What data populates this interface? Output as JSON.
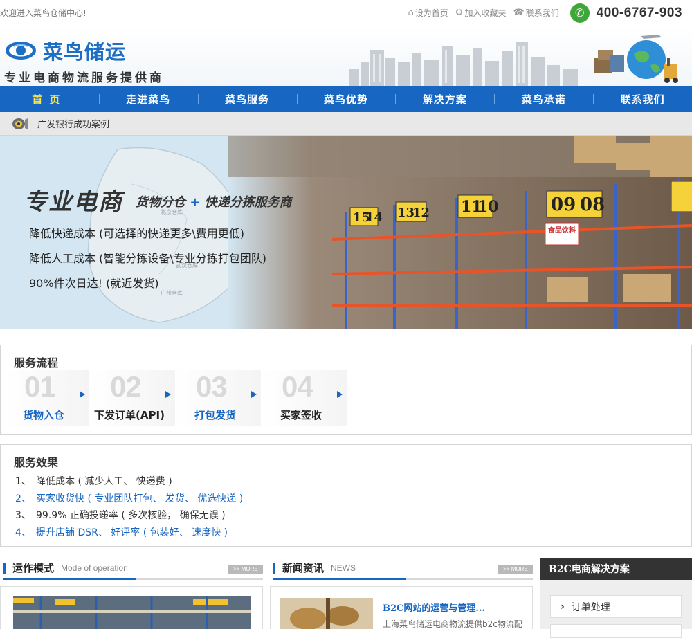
{
  "topbar": {
    "welcome": "欢迎进入菜鸟仓储中心!",
    "set_home": "设为首页",
    "bookmark": "加入收藏夹",
    "contact": "联系我们",
    "phone": "400-6767-903"
  },
  "brand": {
    "logo_text": "菜鸟储运",
    "slogan": "专业电商物流服务提供商"
  },
  "nav": [
    "首页",
    "走进菜鸟",
    "菜鸟服务",
    "菜鸟优势",
    "解决方案",
    "菜鸟承诺",
    "联系我们"
  ],
  "nav_active_index": 0,
  "ticker": {
    "text": "广发银行成功案例"
  },
  "banner": {
    "headline": "专业电商",
    "sub_a": "货物分仓",
    "sub_plus": "+",
    "sub_b": "快递分拣服务商",
    "points": [
      "降低快递成本 (可选择的快递更多\\费用更低)",
      "降低人工成本 (智能分拣设备\\专业分拣打包团队)",
      "90%件次日达! (就近发货)"
    ],
    "map_labels": [
      "北京仓库",
      "武汉仓库",
      "广州仓库"
    ],
    "shelf_numbers": [
      "15",
      "14",
      "13",
      "12",
      "11",
      "10",
      "09",
      "08"
    ],
    "shelf_signs": [
      "食品饮料"
    ]
  },
  "flow": {
    "title": "服务流程",
    "steps": [
      {
        "num": "01",
        "label": "货物入仓",
        "color": "#1766c2"
      },
      {
        "num": "02",
        "label": "下发订单(API)",
        "color": "#222222"
      },
      {
        "num": "03",
        "label": "打包发货",
        "color": "#1766c2"
      },
      {
        "num": "04",
        "label": "买家签收",
        "color": "#222222"
      }
    ]
  },
  "effect": {
    "title": "服务效果",
    "items": [
      {
        "n": "1、",
        "text": "降低成本 ( 减少人工、 快递费 )",
        "blue": false
      },
      {
        "n": "2、",
        "text": "买家收货快 ( 专业团队打包、 发货、 优选快递 )",
        "blue": true
      },
      {
        "n": "3、",
        "text": "99.9% 正确投递率 ( 多次核验， 确保无误 )",
        "blue": false
      },
      {
        "n": "4、",
        "text": "提升店铺 DSR、 好评率 ( 包装好、 速度快 )",
        "blue": true
      }
    ]
  },
  "sections": {
    "operation": {
      "title": "运作模式",
      "en": "Mode of operation",
      "more": ">> MORE"
    },
    "news": {
      "title": "新闻资讯",
      "en": "NEWS",
      "more": ">> MORE",
      "item_title": "B2C网站的运营与管理...",
      "item_body": "上海菜鸟储运电商物流提供b2c物流配"
    },
    "side": {
      "title": "B2C电商解决方案",
      "item": "订单处理"
    }
  },
  "colors": {
    "brand_blue": "#1766c2",
    "nav_active": "#ffe34a",
    "phone_green": "#3fa63a"
  }
}
